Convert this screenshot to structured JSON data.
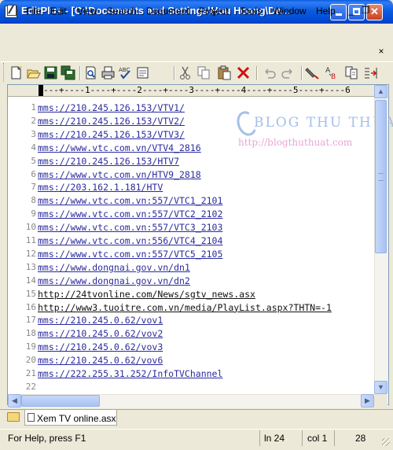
{
  "window": {
    "title": "EditPlus - [C:\\Documents and Settings\\Huu Hoang\\De..."
  },
  "menu": [
    "File",
    "Edit",
    "View",
    "Search",
    "Document",
    "Project",
    "Tools",
    "Window",
    "Help"
  ],
  "toolbar": {
    "icons": [
      "new-file-icon",
      "open-folder-icon",
      "save-icon",
      "save-all-icon",
      "print-preview-icon",
      "print-icon",
      "spellcheck-icon",
      "browser-icon",
      "cut-icon",
      "copy-icon",
      "paste-icon",
      "delete-icon",
      "undo-icon",
      "redo-icon",
      "marker-icon",
      "word-wrap-icon",
      "file-compare-icon",
      "indent-icon"
    ]
  },
  "ruler": {
    "text": "---+----1----+----2----+----3----+----4----+----5----+----6"
  },
  "editor": {
    "lines": [
      {
        "num": "1",
        "text": "mms://210.245.126.153/VTV1/"
      },
      {
        "num": "2",
        "text": "mms://210.245.126.153/VTV2/"
      },
      {
        "num": "3",
        "text": "mms://210.245.126.153/VTV3/"
      },
      {
        "num": "4",
        "text": "mms://www.vtc.com.vn/VTV4_2816"
      },
      {
        "num": "5",
        "text": "mms://210.245.126.153/HTV7"
      },
      {
        "num": "6",
        "text": "mms://www.vtc.com.vn/HTV9_2818"
      },
      {
        "num": "7",
        "text": "mms://203.162.1.181/HTV"
      },
      {
        "num": "8",
        "text": "mms://www.vtc.com.vn:557/VTC1_2101"
      },
      {
        "num": "9",
        "text": "mms://www.vtc.com.vn:557/VTC2_2102"
      },
      {
        "num": "10",
        "text": "mms://www.vtc.com.vn:557/VTC3_2103"
      },
      {
        "num": "11",
        "text": "mms://www.vtc.com.vn:556/VTC4_2104"
      },
      {
        "num": "12",
        "text": "mms://www.vtc.com.vn:557/VTC5_2105"
      },
      {
        "num": "13",
        "text": "mms://www.dongnai.gov.vn/dn1"
      },
      {
        "num": "14",
        "text": "mms://www.dongnai.gov.vn/dn2"
      },
      {
        "num": "15",
        "text": "http://24tvonline.com/News/sgtv_news.asx"
      },
      {
        "num": "16",
        "text": "http://www3.tuoitre.com.vn/media/PlayList.aspx?THTN=-1"
      },
      {
        "num": "17",
        "text": "mms://210.245.0.62/vov1"
      },
      {
        "num": "18",
        "text": "mms://210.245.0.62/vov2"
      },
      {
        "num": "19",
        "text": "mms://210.245.0.62/vov3"
      },
      {
        "num": "20",
        "text": "mms://210.245.0.62/vov6"
      },
      {
        "num": "21",
        "text": "mms://222.255.31.252/InfoTVChannel"
      },
      {
        "num": "22",
        "text": ""
      }
    ]
  },
  "watermark": {
    "title": "BLOG THU THUAT",
    "url": "http://blogthuthuat.com"
  },
  "tabs": {
    "file_tab": "Xem TV online.asx"
  },
  "status": {
    "help": "For Help, press F1",
    "line": "ln 24",
    "col": "col 1",
    "chars": "28"
  },
  "colors": {
    "titlebar": "#0a5ce0",
    "link": "#2b2b9e",
    "watermark_title": "#9bb9e6",
    "watermark_url": "#e8a6d6"
  }
}
